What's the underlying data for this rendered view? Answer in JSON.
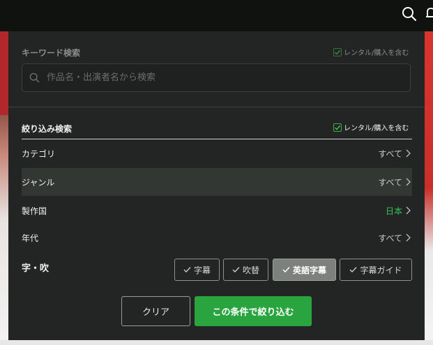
{
  "header": {
    "search_icon": "search-icon",
    "bell_icon": "bell-icon"
  },
  "keyword": {
    "title": "キーワード検索",
    "include_rental_label": "レンタル/購入を含む",
    "include_rental_checked": true,
    "placeholder": "作品名・出演者名から検索",
    "value": ""
  },
  "filter": {
    "title": "絞り込み検索",
    "include_rental_label": "レンタル/購入を含む",
    "include_rental_checked": true,
    "rows": [
      {
        "label": "カテゴリ",
        "value": "すべて"
      },
      {
        "label": "ジャンル",
        "value": "すべて"
      },
      {
        "label": "製作国",
        "value": "日本"
      },
      {
        "label": "年代",
        "value": "すべて"
      }
    ],
    "language": {
      "label": "字・吹",
      "options": [
        {
          "label": "字幕",
          "selected": false
        },
        {
          "label": "吹替",
          "selected": false
        },
        {
          "label": "英語字幕",
          "selected": true
        },
        {
          "label": "字幕ガイド",
          "selected": false
        }
      ]
    }
  },
  "actions": {
    "clear_label": "クリア",
    "apply_label": "この条件で絞り込む"
  },
  "colors": {
    "accent_green": "#2aa43e",
    "highlight_value": "#34c759",
    "panel_bg": "#222523"
  }
}
